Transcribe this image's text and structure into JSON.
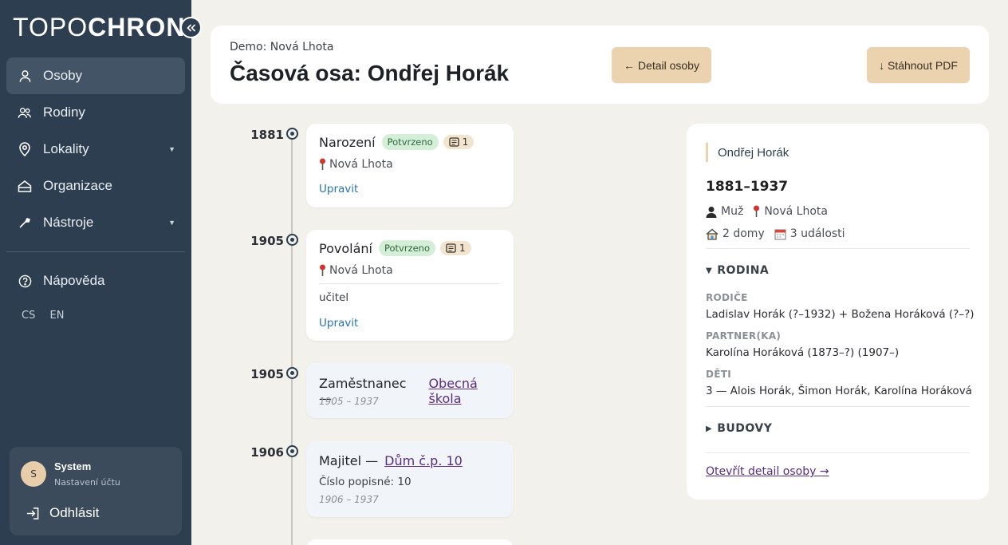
{
  "sidebar": {
    "logo_part1": "TOPO",
    "logo_part2": "CHRON",
    "items": [
      {
        "label": "Osoby",
        "icon": "person-icon"
      },
      {
        "label": "Rodiny",
        "icon": "people-icon"
      },
      {
        "label": "Lokality",
        "icon": "location-pin-icon",
        "has_submenu": true
      },
      {
        "label": "Organizace",
        "icon": "building-icon"
      },
      {
        "label": "Nástroje",
        "icon": "wrench-icon",
        "has_submenu": true
      }
    ],
    "help_label": "Nápověda",
    "languages": [
      "CS",
      "EN"
    ],
    "user": {
      "initial": "S",
      "name": "System",
      "settings": "Nastavení účtu",
      "logout": "Odhlásit"
    }
  },
  "header": {
    "subtitle": "Demo: Nová Lhota",
    "title": "Časová osa: Ondřej Horák",
    "detail_button": "← Detail osoby",
    "pdf_button": "↓ Stáhnout PDF"
  },
  "timeline": [
    {
      "year": "1881",
      "title": "Narození",
      "badge": "Potvrzeno",
      "sources": "1",
      "place": "Nová Lhota",
      "edit": "Upravit"
    },
    {
      "year": "1905",
      "title": "Povolání",
      "badge": "Potvrzeno",
      "sources": "1",
      "place": "Nová Lhota",
      "note": "učitel",
      "edit": "Upravit"
    },
    {
      "year": "1905",
      "title": "Zaměstnanec —",
      "ref": "Obecná škola",
      "range": "1905 – 1937"
    },
    {
      "year": "1906",
      "title": "Majitel —",
      "ref": "Dům č.p. 10",
      "note": "Číslo popisné: 10",
      "range": "1906 – 1937"
    }
  ],
  "person": {
    "name": "Ondřej Horák",
    "years": "1881–1937",
    "sex": "Muž",
    "place": "Nová Lhota",
    "houses": "2 domy",
    "events": "3 události",
    "family_heading": "RODINA",
    "parents_label": "RODIČE",
    "parents": "Ladislav Horák (?–1932) + Božena Horáková (?–?)",
    "partner_label": "PARTNER(KA)",
    "partner": "Karolína Horáková (1873–?) (1907–)",
    "children_label": "DĚTI",
    "children": "3 — Alois Horák, Šimon Horák, Karolína Horáková",
    "buildings_heading": "BUDOVY",
    "open_detail": "Otevřít detail osoby →"
  },
  "colors": {
    "sidebar_bg": "#2c3e50",
    "accent_button": "#ebd3b0",
    "badge_confirmed": "#d5eed8",
    "link": "#2773b8",
    "ref_link": "#5a2d82"
  }
}
